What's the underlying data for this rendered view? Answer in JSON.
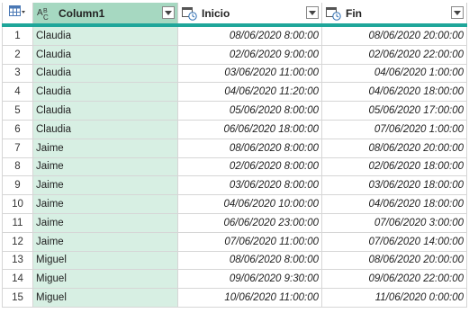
{
  "columns": [
    {
      "title": "Column1",
      "type_icon": "text-type-icon"
    },
    {
      "title": "Inicio",
      "type_icon": "datetime-type-icon"
    },
    {
      "title": "Fin",
      "type_icon": "datetime-type-icon"
    }
  ],
  "colors": {
    "accent": "#1fa69a",
    "selected_header": "#a6d8c1",
    "selected_cells": "#d7efe3"
  },
  "rows": [
    {
      "n": "1",
      "name": "Claudia",
      "inicio": "08/06/2020 8:00:00",
      "fin": "08/06/2020 20:00:00"
    },
    {
      "n": "2",
      "name": "Claudia",
      "inicio": "02/06/2020 9:00:00",
      "fin": "02/06/2020 22:00:00"
    },
    {
      "n": "3",
      "name": "Claudia",
      "inicio": "03/06/2020 11:00:00",
      "fin": "04/06/2020 1:00:00"
    },
    {
      "n": "4",
      "name": "Claudia",
      "inicio": "04/06/2020 11:20:00",
      "fin": "04/06/2020 18:00:00"
    },
    {
      "n": "5",
      "name": "Claudia",
      "inicio": "05/06/2020 8:00:00",
      "fin": "05/06/2020 17:00:00"
    },
    {
      "n": "6",
      "name": "Claudia",
      "inicio": "06/06/2020 18:00:00",
      "fin": "07/06/2020 1:00:00"
    },
    {
      "n": "7",
      "name": "Jaime",
      "inicio": "08/06/2020 8:00:00",
      "fin": "08/06/2020 20:00:00"
    },
    {
      "n": "8",
      "name": "Jaime",
      "inicio": "02/06/2020 8:00:00",
      "fin": "02/06/2020 18:00:00"
    },
    {
      "n": "9",
      "name": "Jaime",
      "inicio": "03/06/2020 8:00:00",
      "fin": "03/06/2020 18:00:00"
    },
    {
      "n": "10",
      "name": "Jaime",
      "inicio": "04/06/2020 10:00:00",
      "fin": "04/06/2020 18:00:00"
    },
    {
      "n": "11",
      "name": "Jaime",
      "inicio": "06/06/2020 23:00:00",
      "fin": "07/06/2020 3:00:00"
    },
    {
      "n": "12",
      "name": "Jaime",
      "inicio": "07/06/2020 11:00:00",
      "fin": "07/06/2020 14:00:00"
    },
    {
      "n": "13",
      "name": "Miguel",
      "inicio": "08/06/2020 8:00:00",
      "fin": "08/06/2020 20:00:00"
    },
    {
      "n": "14",
      "name": "Miguel",
      "inicio": "09/06/2020 9:30:00",
      "fin": "09/06/2020 22:00:00"
    },
    {
      "n": "15",
      "name": "Miguel",
      "inicio": "10/06/2020 11:00:00",
      "fin": "11/06/2020 0:00:00"
    }
  ]
}
